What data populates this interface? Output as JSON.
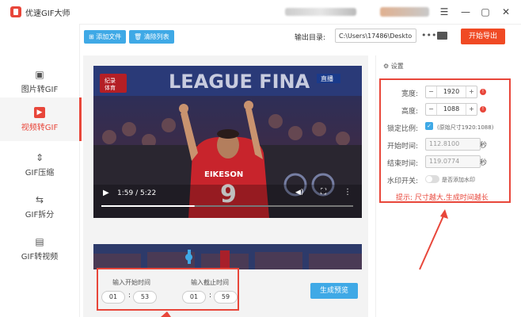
{
  "app": {
    "title": "优速GIF大师"
  },
  "window": {
    "menu_icon": "hamburger-icon",
    "minimize_icon": "minimize-icon",
    "maximize_icon": "maximize-icon",
    "close_icon": "close-icon"
  },
  "sidebar": {
    "items": [
      {
        "label": "图片转GIF",
        "icon": "image-file-icon",
        "active": false
      },
      {
        "label": "视频转GIF",
        "icon": "video-file-icon",
        "active": true
      },
      {
        "label": "GIF压缩",
        "icon": "compress-icon",
        "active": false
      },
      {
        "label": "GIF拆分",
        "icon": "split-icon",
        "active": false
      },
      {
        "label": "GIF转视频",
        "icon": "gif-file-icon",
        "active": false
      }
    ]
  },
  "toolbar": {
    "add_file": "添加文件",
    "clear_list": "清除列表",
    "output_label": "输出目录:",
    "output_path": "C:\\Users\\17486\\Deskto",
    "more_icon": "more-icon",
    "folder_icon": "folder-icon",
    "start_button": "开始导出"
  },
  "player": {
    "time": "1:59 / 5:22",
    "overlay_badge": "直播",
    "overlay_logo": [
      "纪录",
      "体育"
    ],
    "jersey_name": "EIKESON",
    "jersey_number": "9",
    "banner_text": "LEAGUE FINA",
    "progress_fraction": 0.37
  },
  "trim": {
    "start_label": "输入开始时间",
    "end_label": "输入截止时间",
    "start_min": "01",
    "start_sec": "53",
    "end_min": "01",
    "end_sec": "59",
    "preview_button": "生成预览"
  },
  "settings": {
    "title": "设置",
    "width_label": "宽度:",
    "width_value": "1920",
    "height_label": "高度:",
    "height_value": "1088",
    "lock_label": "锁定比例:",
    "lock_note": "(原始尺寸1920:1088)",
    "start_label": "开始时间:",
    "start_value": "112.8100",
    "end_label": "结束时间:",
    "end_value": "119.0774",
    "unit": "秒",
    "watermark_label": "水印开关:",
    "watermark_text": "是否添加水印",
    "tip": "提示: 尺寸越大,生成时间越长"
  },
  "colors": {
    "accent": "#e8463a",
    "blue": "#3fa9e6"
  }
}
